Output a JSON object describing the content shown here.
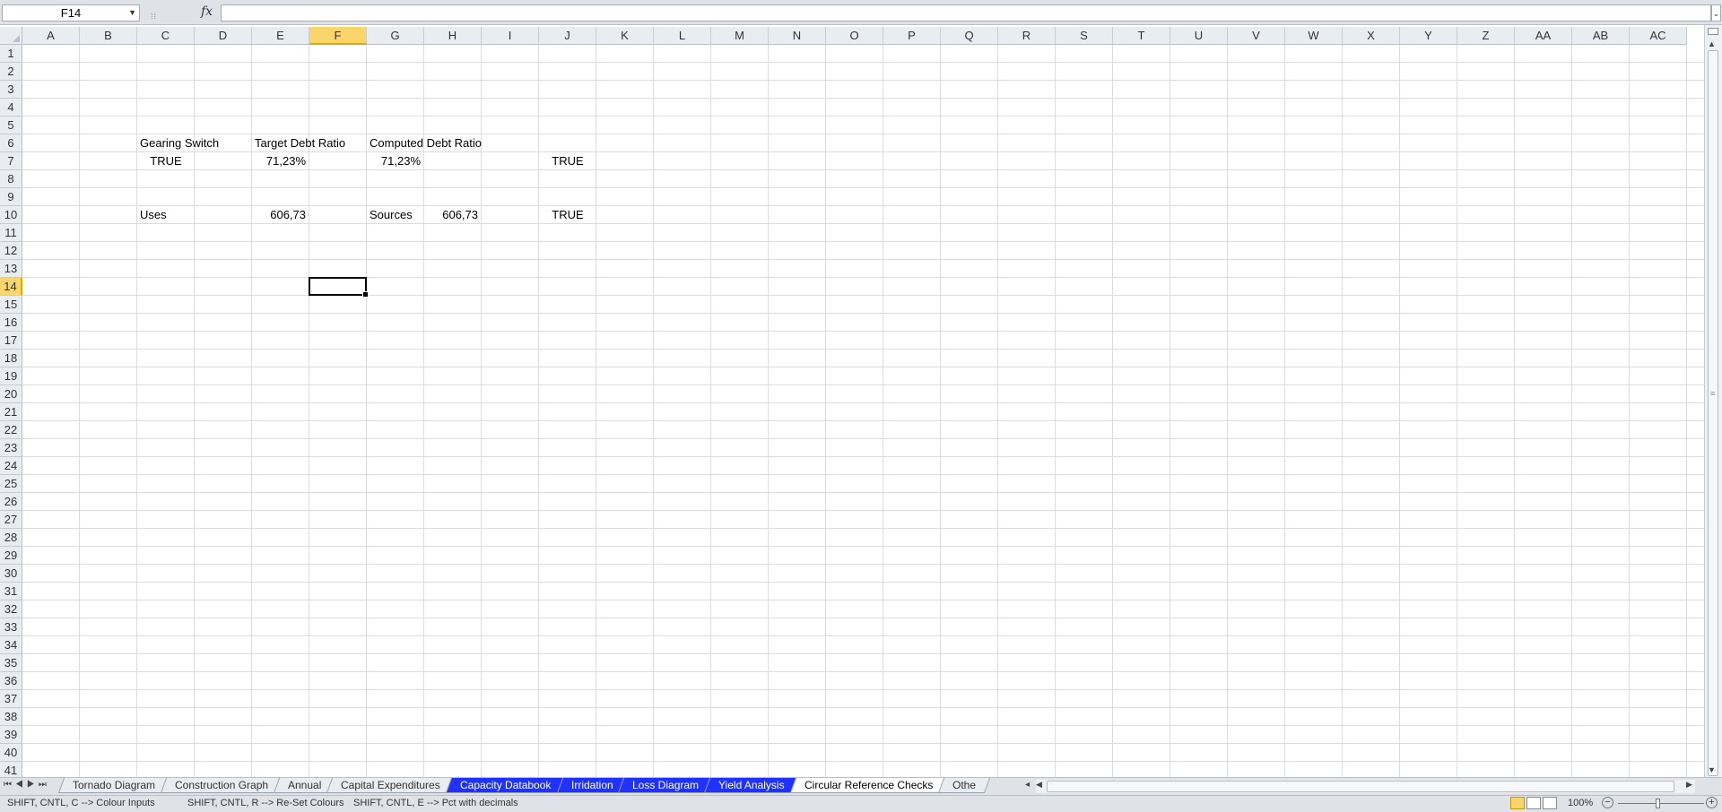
{
  "formula_bar": {
    "name_box": "F14",
    "fx_label": "fx",
    "formula": ""
  },
  "columns": [
    "A",
    "B",
    "C",
    "D",
    "E",
    "F",
    "G",
    "H",
    "I",
    "J",
    "K",
    "L",
    "M",
    "N",
    "O",
    "P",
    "Q",
    "R",
    "S",
    "T",
    "U",
    "V",
    "W",
    "X",
    "Y",
    "Z",
    "AA",
    "AB",
    "AC"
  ],
  "rows": [
    "1",
    "2",
    "3",
    "4",
    "5",
    "6",
    "7",
    "8",
    "9",
    "10",
    "11",
    "12",
    "13",
    "14",
    "15",
    "16",
    "17",
    "18",
    "19",
    "20",
    "21",
    "22",
    "23",
    "24",
    "25",
    "26",
    "27",
    "28",
    "29",
    "30",
    "31",
    "32",
    "33",
    "34",
    "35",
    "36",
    "37",
    "38",
    "39",
    "40",
    "41"
  ],
  "selected": {
    "column": "F",
    "row": "14"
  },
  "cells": {
    "C6": "Gearing Switch",
    "E6": "Target Debt Ratio",
    "G6": "Computed Debt Ratio",
    "C7": "TRUE",
    "E7": "71,23%",
    "G7": "71,23%",
    "J7": "TRUE",
    "C10": "Uses",
    "E10": "606,73",
    "G10": "Sources",
    "H10": "606,73",
    "J10": "TRUE"
  },
  "sheet_tabs": [
    {
      "label": "Tornado Diagram",
      "style": "normal"
    },
    {
      "label": "Construction Graph",
      "style": "normal"
    },
    {
      "label": "Annual",
      "style": "normal"
    },
    {
      "label": "Capital Expenditures",
      "style": "normal"
    },
    {
      "label": "Capacity Databook",
      "style": "blue"
    },
    {
      "label": "Irridation",
      "style": "blue"
    },
    {
      "label": "Loss Diagram",
      "style": "blue"
    },
    {
      "label": "Yield Analysis",
      "style": "blue"
    },
    {
      "label": "Circular Reference Checks",
      "style": "active"
    },
    {
      "label": "Othe",
      "style": "normal"
    }
  ],
  "status": {
    "msg1": "SHIFT, CNTL, C --> Colour Inputs",
    "msg2": "SHIFT, CNTL, R --> Re-Set Colours",
    "msg3": "SHIFT, CNTL, E --> Pct with decimals",
    "zoom": "100%"
  },
  "colors": {
    "selected_header": "#f9d56c",
    "blue_tab": "#1f32ff"
  }
}
